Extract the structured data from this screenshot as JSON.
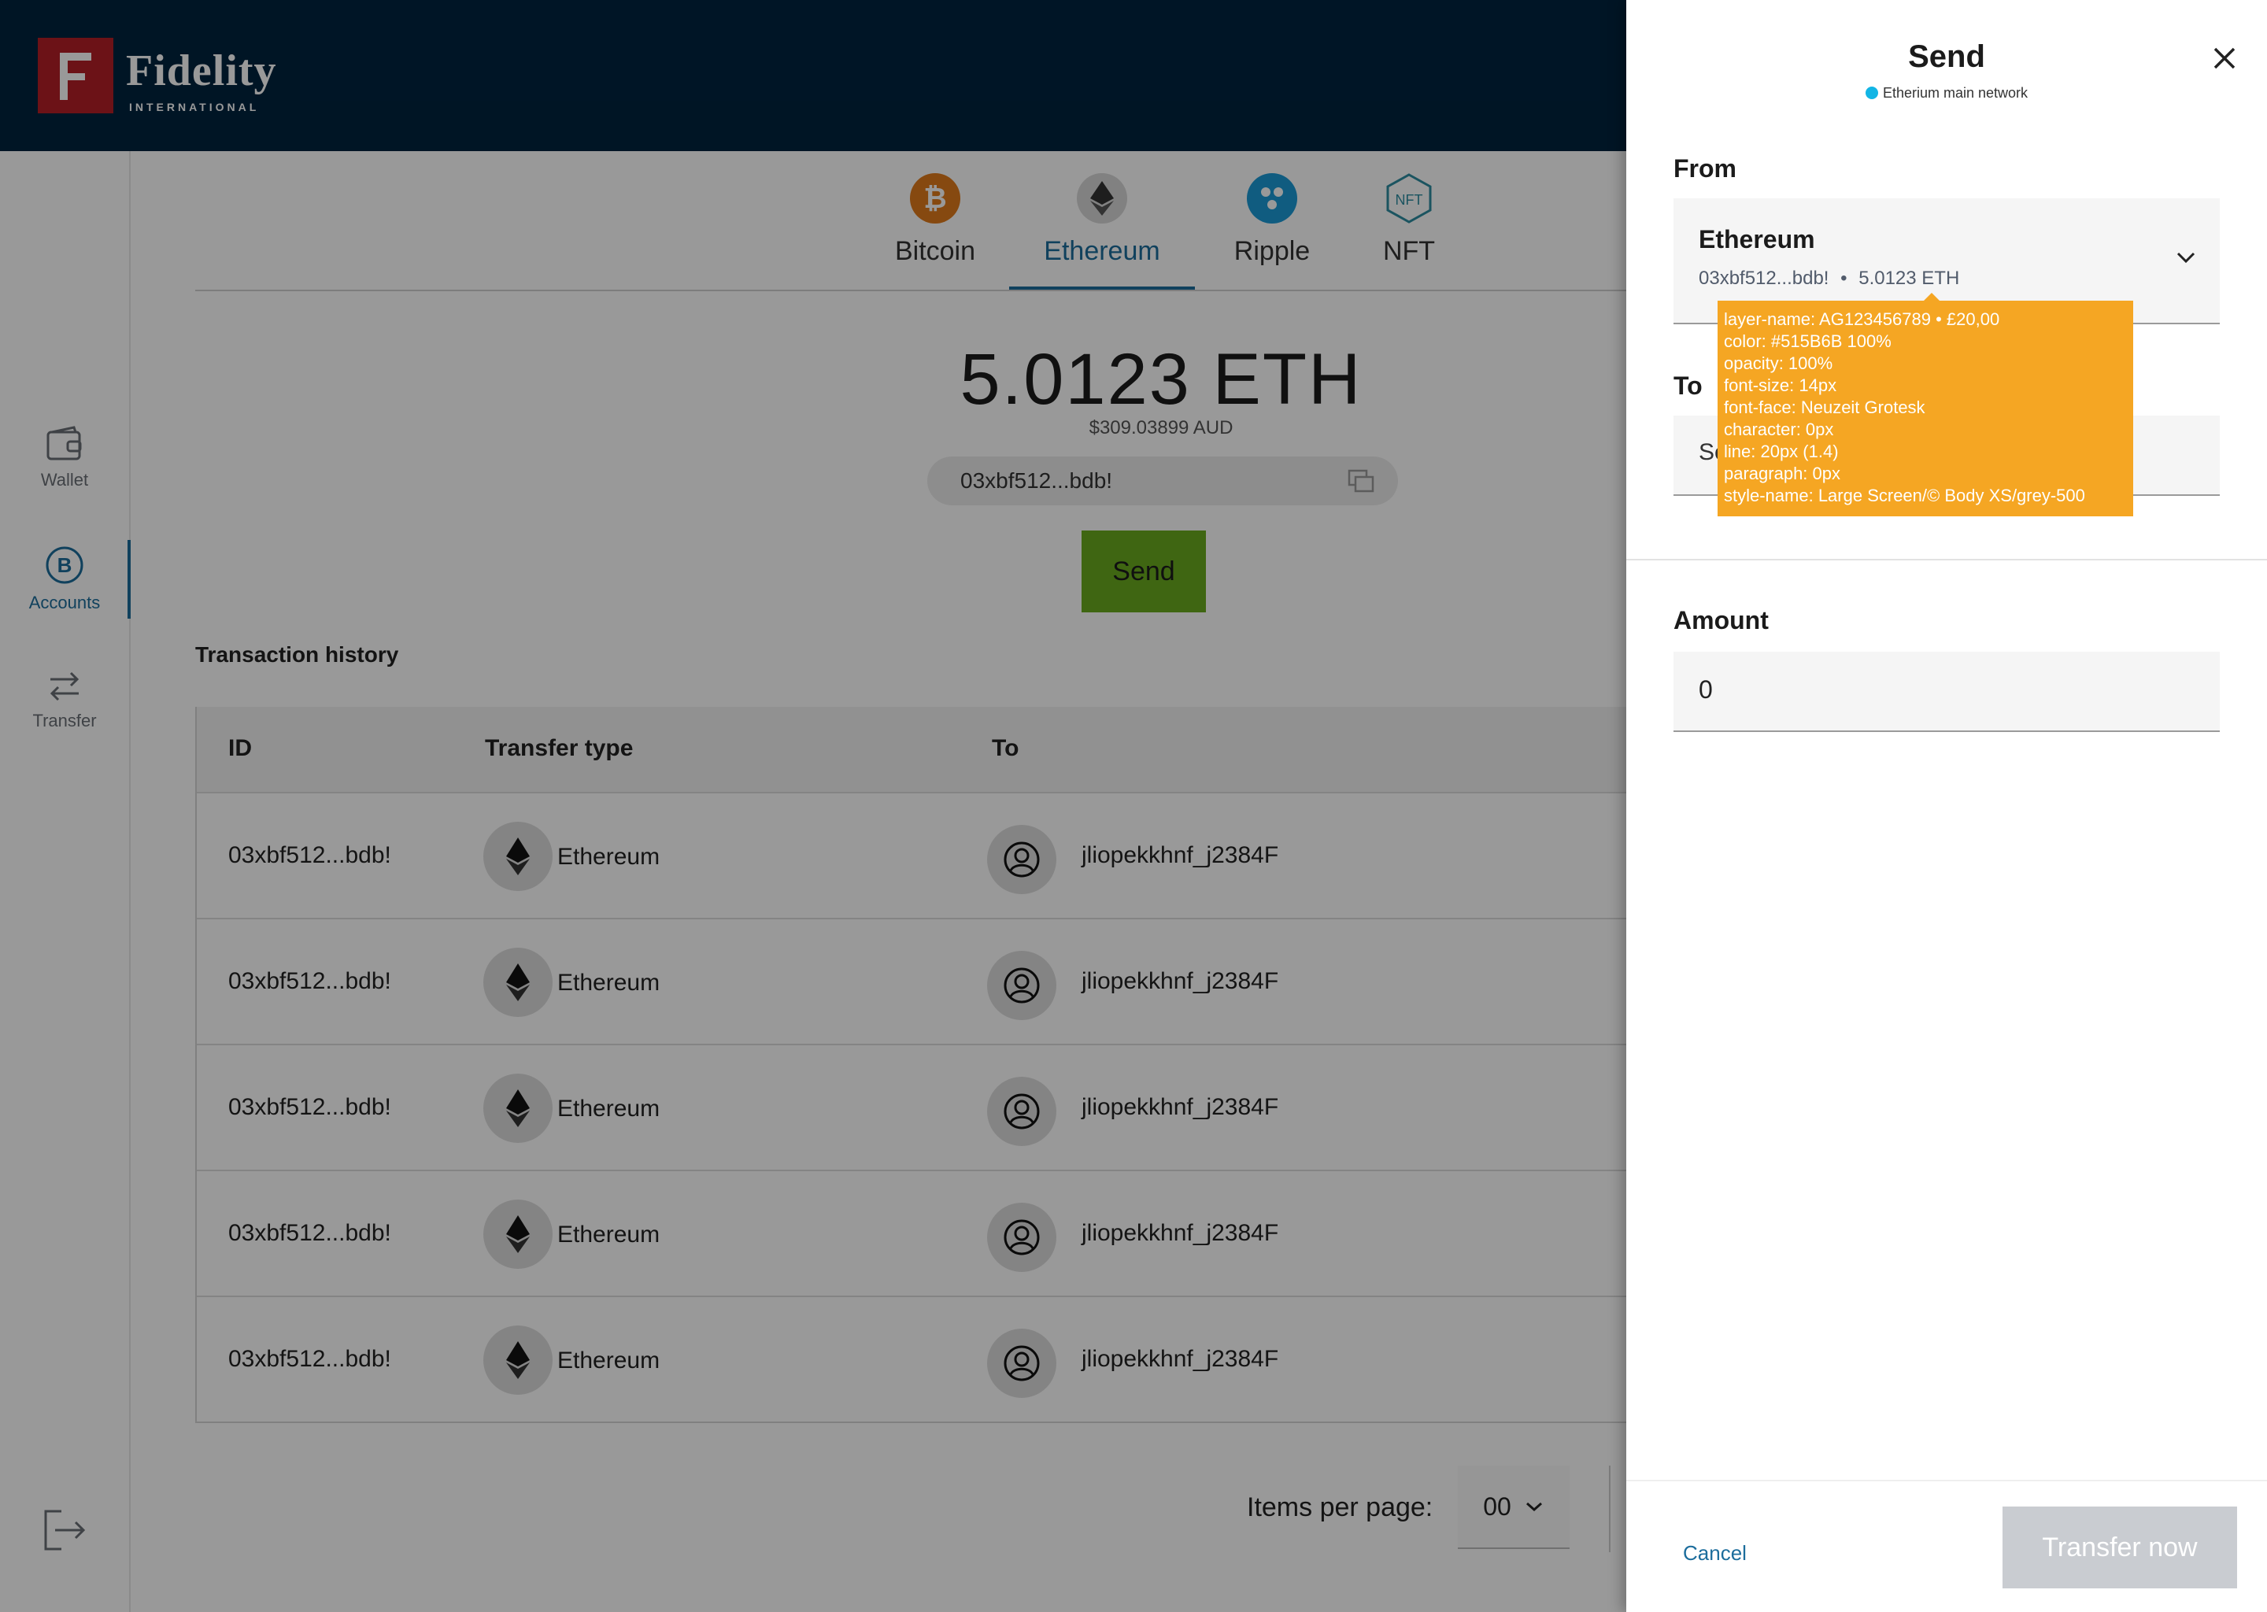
{
  "brand": {
    "name": "Fidelity",
    "sub": "INTERNATIONAL",
    "mark": "F"
  },
  "sidebar": {
    "items": [
      {
        "label": "Wallet",
        "icon": "wallet-icon"
      },
      {
        "label": "Accounts",
        "icon": "bitcoin-circle-icon",
        "active": true
      },
      {
        "label": "Transfer",
        "icon": "transfer-arrows-icon"
      }
    ],
    "logout_icon": "logout-icon"
  },
  "tabs": [
    {
      "label": "Bitcoin",
      "icon": "bitcoin-icon",
      "color": "#e07b1c"
    },
    {
      "label": "Ethereum",
      "icon": "ethereum-icon",
      "color": "#d7d7d7",
      "active": true
    },
    {
      "label": "Ripple",
      "icon": "ripple-icon",
      "color": "#1b9ad6"
    },
    {
      "label": "NFT",
      "icon": "nft-icon",
      "color": "#2d8ca0"
    }
  ],
  "balance": {
    "amount": "5.0123 ETH",
    "fiat": "$309.03899 AUD",
    "address": "03xbf512...bdb!"
  },
  "send_label": "Send",
  "history": {
    "title": "Transaction history",
    "columns": [
      "ID",
      "Transfer type",
      "To"
    ],
    "rows": [
      {
        "id": "03xbf512...bdb!",
        "type": "Ethereum",
        "to": "jliopekkhnf_j2384F"
      },
      {
        "id": "03xbf512...bdb!",
        "type": "Ethereum",
        "to": "jliopekkhnf_j2384F"
      },
      {
        "id": "03xbf512...bdb!",
        "type": "Ethereum",
        "to": "jliopekkhnf_j2384F"
      },
      {
        "id": "03xbf512...bdb!",
        "type": "Ethereum",
        "to": "jliopekkhnf_j2384F"
      },
      {
        "id": "03xbf512...bdb!",
        "type": "Ethereum",
        "to": "jliopekkhnf_j2384F"
      }
    ]
  },
  "pager": {
    "label": "Items per page:",
    "value": "00"
  },
  "panel": {
    "title": "Send",
    "network": "Etherium main network",
    "from_label": "From",
    "from_name": "Ethereum",
    "from_address": "03xbf512...bdb!",
    "from_bullet": "•",
    "from_amount": "5.0123 ETH",
    "to_label": "To",
    "to_value": "Se",
    "amount_label": "Amount",
    "amount_value": "0",
    "cancel_label": "Cancel",
    "transfer_label": "Transfer now"
  },
  "tooltip": {
    "lines": [
      "layer-name: AG123456789 • £20,00",
      "color: #515B6B 100%",
      "opacity: 100%",
      "font-size: 14px",
      "font-face: Neuzeit Grotesk",
      "character: 0px",
      "line: 20px (1.4)",
      "paragraph: 0px",
      "style-name: Large Screen/© Body XS/grey-500"
    ]
  },
  "colors": {
    "header_bg": "#00233f",
    "brand_red": "#b51e27",
    "accent_blue": "#1c6d9c",
    "send_green": "#6aaa1e",
    "tooltip_orange": "#f5a623",
    "network_dot": "#12b5e5",
    "transfer_disabled": "#c9ccd1"
  }
}
